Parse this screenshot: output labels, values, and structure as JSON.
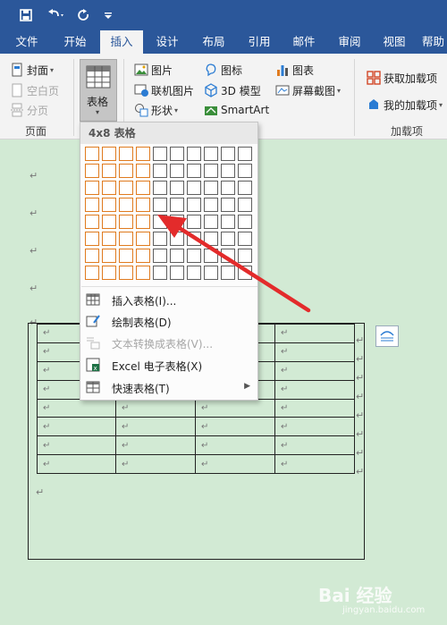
{
  "tabs": [
    "文件",
    "开始",
    "插入",
    "设计",
    "布局",
    "引用",
    "邮件",
    "审阅",
    "视图",
    "帮助"
  ],
  "ribbon": {
    "page_group": {
      "items": [
        "封面",
        "空白页",
        "分页"
      ],
      "label": "页面"
    },
    "table_button": "表格",
    "illustrations": [
      "图片",
      "联机图片",
      "形状",
      "图标",
      "3D 模型",
      "SmartArt",
      "图表",
      "屏幕截图"
    ],
    "addins_group": {
      "items": [
        "获取加载项",
        "我的加载项"
      ],
      "label": "加载项"
    }
  },
  "table_menu": {
    "header": "4x8 表格",
    "grid": {
      "rows": 8,
      "cols": 10,
      "selected_cols": 4,
      "selected_rows": 8
    },
    "items": [
      {
        "label": "插入表格(I)...",
        "enabled": true,
        "submenu": false
      },
      {
        "label": "绘制表格(D)",
        "enabled": true,
        "submenu": false
      },
      {
        "label": "文本转换成表格(V)...",
        "enabled": false,
        "submenu": false
      },
      {
        "label": "Excel 电子表格(X)",
        "enabled": true,
        "submenu": false
      },
      {
        "label": "快速表格(T)",
        "enabled": true,
        "submenu": true
      }
    ]
  },
  "document": {
    "paragraph_mark": "↵",
    "table": {
      "rows": 8,
      "cols": 4
    }
  },
  "watermark": {
    "text": "Bai 经验",
    "sub": "jingyan.baidu.com"
  },
  "colors": {
    "titlebar": "#2b579a",
    "document_bg": "#d2ead4",
    "grid_selected": "#e07b1f",
    "arrow": "#e32b2b"
  }
}
